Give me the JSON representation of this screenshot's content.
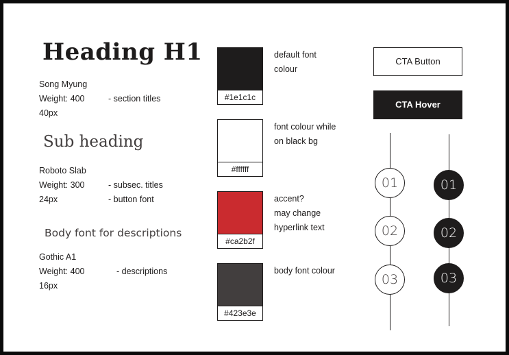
{
  "typography": {
    "heading": {
      "sample": "Heading H1",
      "font": "Song Myung",
      "weight": "Weight: 400",
      "usage": "- section titles",
      "size": "40px"
    },
    "subheading": {
      "sample": "Sub heading",
      "font": "Roboto Slab",
      "weight": "Weight: 300",
      "usage": "- subsec. titles",
      "size": "24px",
      "usage2": "- button font"
    },
    "body": {
      "sample": "Body font for descriptions",
      "font": "Gothic A1",
      "weight": "Weight: 400",
      "usage": "- descriptions",
      "size": "16px"
    }
  },
  "colors": [
    {
      "hex": "#1e1c1c",
      "code": "#1e1c1c",
      "note_lines": [
        "default font",
        "colour"
      ]
    },
    {
      "hex": "#ffffff",
      "code": "#ffffff",
      "note_lines": [
        "font colour while",
        "on black bg"
      ]
    },
    {
      "hex": "#ca2b2f",
      "code": "#ca2b2f",
      "note_lines": [
        "accent?",
        "may change",
        "hyperlink text"
      ]
    },
    {
      "hex": "#423e3e",
      "code": "#423e3e",
      "note_lines": [
        "body font colour"
      ]
    }
  ],
  "buttons": {
    "default_label": "CTA Button",
    "hover_label": "CTA Hover"
  },
  "steps_light": [
    "01",
    "02",
    "03"
  ],
  "steps_dark": [
    "01",
    "02",
    "03"
  ]
}
